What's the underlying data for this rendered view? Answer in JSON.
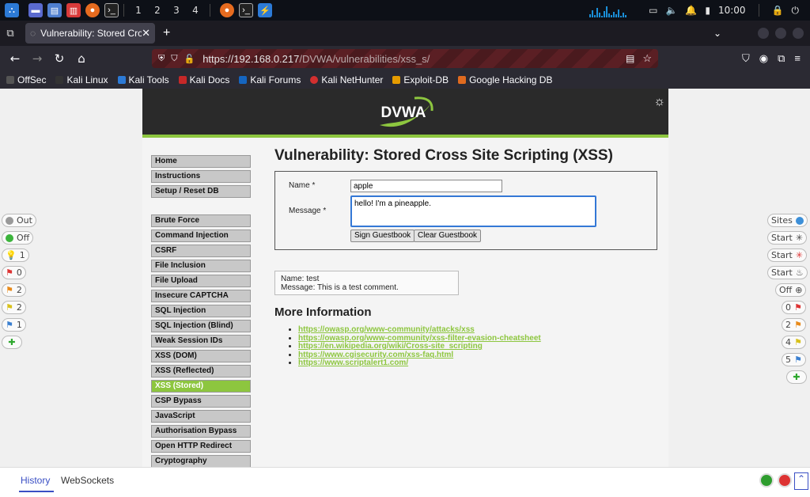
{
  "taskbar": {
    "workspaces": [
      "1",
      "2",
      "3",
      "4"
    ],
    "clock": "10:00"
  },
  "browser": {
    "tab_title": "Vulnerability: Stored Cros",
    "url_host": "https://192.168.0.217",
    "url_path": "/DVWA/vulnerabilities/xss_s/",
    "bookmarks": [
      "OffSec",
      "Kali Linux",
      "Kali Tools",
      "Kali Docs",
      "Kali Forums",
      "Kali NetHunter",
      "Exploit-DB",
      "Google Hacking DB"
    ]
  },
  "dvwa": {
    "logo": "DVWA",
    "menu_top": [
      "Home",
      "Instructions",
      "Setup / Reset DB"
    ],
    "menu_vulns": [
      "Brute Force",
      "Command Injection",
      "CSRF",
      "File Inclusion",
      "File Upload",
      "Insecure CAPTCHA",
      "SQL Injection",
      "SQL Injection (Blind)",
      "Weak Session IDs",
      "XSS (DOM)",
      "XSS (Reflected)",
      "XSS (Stored)",
      "CSP Bypass",
      "JavaScript",
      "Authorisation Bypass",
      "Open HTTP Redirect",
      "Cryptography"
    ],
    "active_item": "XSS (Stored)",
    "title": "Vulnerability: Stored Cross Site Scripting (XSS)",
    "form": {
      "name_label": "Name *",
      "name_value": "apple",
      "message_label": "Message *",
      "message_value": "hello! I'm a pineapple.",
      "sign_button": "Sign Guestbook",
      "clear_button": "Clear Guestbook"
    },
    "comment": {
      "name_line": "Name: test",
      "message_line": "Message: This is a test comment."
    },
    "more_info_title": "More Information",
    "links": [
      "https://owasp.org/www-community/attacks/xss",
      "https://owasp.org/www-community/xss-filter-evasion-cheatsheet",
      "https://en.wikipedia.org/wiki/Cross-site_scripting",
      "https://www.cgisecurity.com/xss-faq.html",
      "https://www.scriptalert1.com/"
    ]
  },
  "left_pills": [
    "Out",
    "Off",
    "1",
    "0",
    "2",
    "2",
    "1"
  ],
  "right_pills": [
    "Sites",
    "Start",
    "Start",
    "Start",
    "Off",
    "0",
    "2",
    "4",
    "5"
  ],
  "bottom_tabs": [
    "History",
    "WebSockets"
  ]
}
